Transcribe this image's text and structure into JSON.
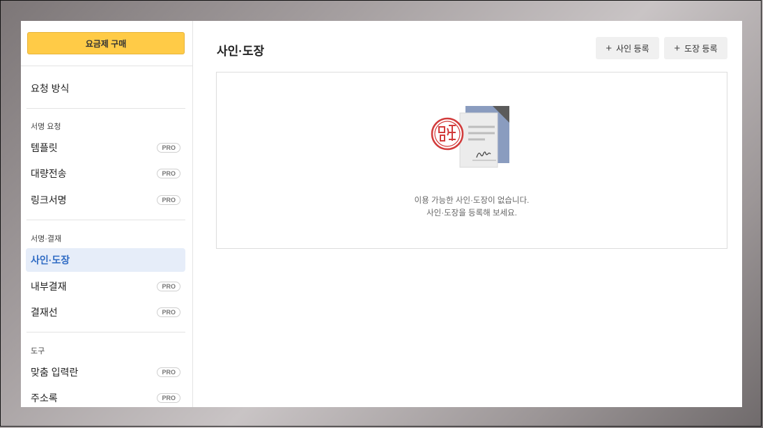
{
  "sidebar": {
    "buy_button": "요금제 구매",
    "request_method": "요청 방식",
    "sections": {
      "signature_request": "서명 요청",
      "signature_approval": "서명·결재",
      "tools": "도구"
    },
    "items": {
      "template": "템플릿",
      "bulk_send": "대량전송",
      "link_sign": "링크서명",
      "sign_stamp": "사인·도장",
      "internal_approval": "내부결재",
      "approval_line": "결재선",
      "custom_input": "맞춤 입력란",
      "address_book": "주소록"
    },
    "pro_badge": "PRO"
  },
  "main": {
    "title": "사인·도장",
    "add_sign_button": "사인 등록",
    "add_stamp_button": "도장 등록",
    "plus": "+",
    "empty_line1": "이용 가능한 사인·도장이 없습니다.",
    "empty_line2": "사인·도장을 등록해 보세요."
  },
  "colors": {
    "accent_yellow": "#ffcb47",
    "active_bg": "#e6edf9",
    "active_text": "#2f6bc4",
    "stamp_red": "#d23b3b",
    "doc_blue": "#8a9cbf"
  }
}
